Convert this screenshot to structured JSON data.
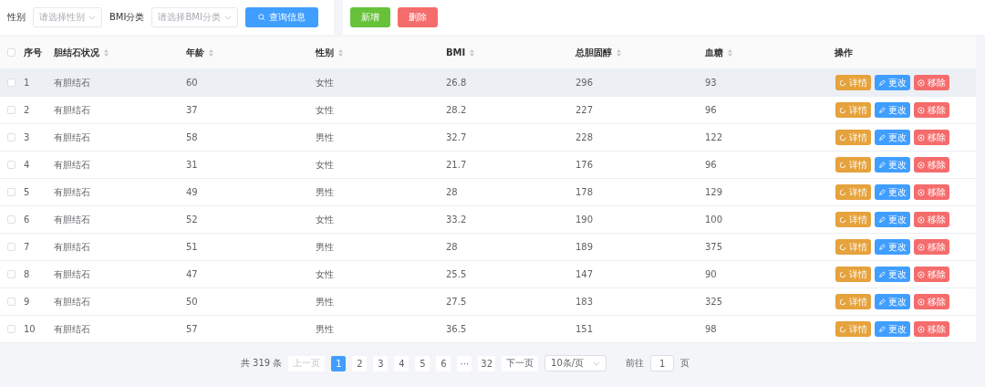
{
  "filters": [
    {
      "label": "性别",
      "placeholder": "请选择性别"
    },
    {
      "label": "BMI分类",
      "placeholder": "请选择BMI分类"
    }
  ],
  "search_button": "查询信息",
  "actions": [
    {
      "label": "新增",
      "kind": "add"
    },
    {
      "label": "删除",
      "kind": "delete"
    }
  ],
  "table": {
    "select_all_checked": false,
    "columns": [
      {
        "label": "序号",
        "sortable": false
      },
      {
        "label": "胆结石状况",
        "sortable": true
      },
      {
        "label": "年龄",
        "sortable": true
      },
      {
        "label": "性别",
        "sortable": true
      },
      {
        "label": "BMI",
        "sortable": true
      },
      {
        "label": "总胆固醇",
        "sortable": true
      },
      {
        "label": "血糖",
        "sortable": true
      },
      {
        "label": "操作",
        "sortable": false
      }
    ],
    "rows": [
      {
        "checked": false,
        "highlighted": true,
        "cells": [
          "1",
          "有胆结石",
          "60",
          "女性",
          "26.8",
          "296",
          "93"
        ],
        "buttons": [
          {
            "label": "详情",
            "kind": "detail"
          },
          {
            "label": "更改",
            "kind": "edit"
          },
          {
            "label": "移除",
            "kind": "remove"
          }
        ]
      },
      {
        "checked": false,
        "highlighted": false,
        "cells": [
          "2",
          "有胆结石",
          "37",
          "女性",
          "28.2",
          "227",
          "96"
        ],
        "buttons": [
          {
            "label": "详情",
            "kind": "detail"
          },
          {
            "label": "更改",
            "kind": "edit"
          },
          {
            "label": "移除",
            "kind": "remove"
          }
        ]
      },
      {
        "checked": false,
        "highlighted": false,
        "cells": [
          "3",
          "有胆结石",
          "58",
          "男性",
          "32.7",
          "228",
          "122"
        ],
        "buttons": [
          {
            "label": "详情",
            "kind": "detail"
          },
          {
            "label": "更改",
            "kind": "edit"
          },
          {
            "label": "移除",
            "kind": "remove"
          }
        ]
      },
      {
        "checked": false,
        "highlighted": false,
        "cells": [
          "4",
          "有胆结石",
          "31",
          "女性",
          "21.7",
          "176",
          "96"
        ],
        "buttons": [
          {
            "label": "详情",
            "kind": "detail"
          },
          {
            "label": "更改",
            "kind": "edit"
          },
          {
            "label": "移除",
            "kind": "remove"
          }
        ]
      },
      {
        "checked": false,
        "highlighted": false,
        "cells": [
          "5",
          "有胆结石",
          "49",
          "男性",
          "28",
          "178",
          "129"
        ],
        "buttons": [
          {
            "label": "详情",
            "kind": "detail"
          },
          {
            "label": "更改",
            "kind": "edit"
          },
          {
            "label": "移除",
            "kind": "remove"
          }
        ]
      },
      {
        "checked": false,
        "highlighted": false,
        "cells": [
          "6",
          "有胆结石",
          "52",
          "女性",
          "33.2",
          "190",
          "100"
        ],
        "buttons": [
          {
            "label": "详情",
            "kind": "detail"
          },
          {
            "label": "更改",
            "kind": "edit"
          },
          {
            "label": "移除",
            "kind": "remove"
          }
        ]
      },
      {
        "checked": false,
        "highlighted": false,
        "cells": [
          "7",
          "有胆结石",
          "51",
          "男性",
          "28",
          "189",
          "375"
        ],
        "buttons": [
          {
            "label": "详情",
            "kind": "detail"
          },
          {
            "label": "更改",
            "kind": "edit"
          },
          {
            "label": "移除",
            "kind": "remove"
          }
        ]
      },
      {
        "checked": false,
        "highlighted": false,
        "cells": [
          "8",
          "有胆结石",
          "47",
          "女性",
          "25.5",
          "147",
          "90"
        ],
        "buttons": [
          {
            "label": "详情",
            "kind": "detail"
          },
          {
            "label": "更改",
            "kind": "edit"
          },
          {
            "label": "移除",
            "kind": "remove"
          }
        ]
      },
      {
        "checked": false,
        "highlighted": false,
        "cells": [
          "9",
          "有胆结石",
          "50",
          "男性",
          "27.5",
          "183",
          "325"
        ],
        "buttons": [
          {
            "label": "详情",
            "kind": "detail"
          },
          {
            "label": "更改",
            "kind": "edit"
          },
          {
            "label": "移除",
            "kind": "remove"
          }
        ]
      },
      {
        "checked": false,
        "highlighted": false,
        "cells": [
          "10",
          "有胆结石",
          "57",
          "男性",
          "36.5",
          "151",
          "98"
        ],
        "buttons": [
          {
            "label": "详情",
            "kind": "detail"
          },
          {
            "label": "更改",
            "kind": "edit"
          },
          {
            "label": "移除",
            "kind": "remove"
          }
        ]
      }
    ]
  },
  "pagination": {
    "total": "共 319 条",
    "prev": "上一页",
    "pages": [
      {
        "label": "1",
        "selected": true
      },
      {
        "label": "2",
        "selected": false
      },
      {
        "label": "3",
        "selected": false
      },
      {
        "label": "4",
        "selected": false
      },
      {
        "label": "5",
        "selected": false
      },
      {
        "label": "6",
        "selected": false
      },
      {
        "label": "···",
        "selected": false
      },
      {
        "label": "32",
        "selected": false
      }
    ],
    "next": "下一页",
    "page_size": "10条/页",
    "goto_label": "前往",
    "goto_value": "1",
    "goto_suffix": "页"
  }
}
